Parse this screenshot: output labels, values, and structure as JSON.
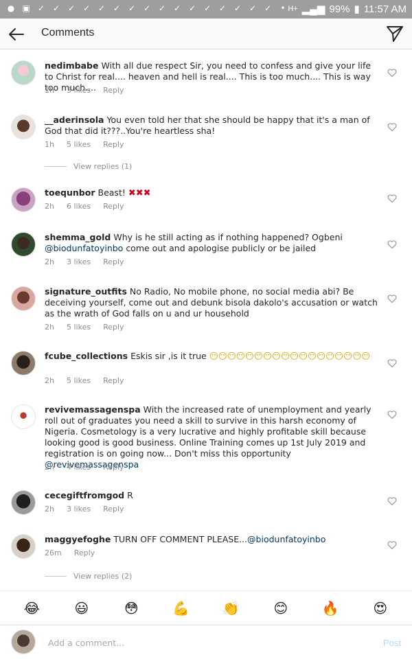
{
  "status_bar": {
    "battery": "99%",
    "time": "11:57 AM",
    "network": "H+"
  },
  "header": {
    "title": "Comments"
  },
  "comments": [
    {
      "user": "nedimbabe",
      "text": "With all due respect Sir, you need to confess and give your life to Christ for real.... heaven and hell is real.... This is too much.... This is way too much....",
      "time": "1h",
      "likes": "3 likes",
      "reply": "Reply"
    },
    {
      "user": "__aderinsola",
      "text": "You even told her that she should be happy that it's a man of God that did it???..You're heartless sha!",
      "time": "1h",
      "likes": "5 likes",
      "reply": "Reply",
      "view_replies": "View replies (1)"
    },
    {
      "user": "toequnbor",
      "text": "Beast!",
      "emoji": "✖✖✖",
      "time": "2h",
      "likes": "6 likes",
      "reply": "Reply"
    },
    {
      "user": "shemma_gold",
      "text_a": "Why is he still acting as if nothing happened? Ogbeni",
      "mention": "@biodunfatoyinbo",
      "text_b": "come out and apologise publicly or be jailed",
      "time": "2h",
      "likes": "3 likes",
      "reply": "Reply"
    },
    {
      "user": "signature_outfits",
      "text": "No Radio, No mobile phone, no social media abi? Be deceiving yourself, come out and debunk bisola dakolo's accusation or watch as the wrath of God falls on u and ur household",
      "time": "2h",
      "likes": "5 likes",
      "reply": "Reply"
    },
    {
      "user": "fcube_collections",
      "text": "Eskis sir ,is it true",
      "emoji": "😶😶😶😶😶😶😶😶😶😶😶😶😶😶😶😶😶😶",
      "time": "2h",
      "likes": "5 likes",
      "reply": "Reply"
    },
    {
      "user": "revivemassagenspa",
      "text": "With the increased rate of unemployment and yearly roll out of graduates you need a skill to survive in this harsh economy of Nigeria. Cosmetology is a very lucrative and highly profitable skill because looking good is good business. Online Training comes up 1st July 2019 and registration is on going now... Don't miss this opportunity",
      "mention": "@revivemassagenspa",
      "time": "2h",
      "likes": "4 likes",
      "reply": "Reply"
    },
    {
      "user": "cecegiftfromgod",
      "text": "R",
      "time": "2h",
      "likes": "3 likes",
      "reply": "Reply"
    },
    {
      "user": "maggyefoghe",
      "text": "TURN OFF COMMENT PLEASE...",
      "mention": "@biodunfatoyinbo",
      "time": "26m",
      "reply": "Reply",
      "view_replies": "View replies (2)"
    }
  ],
  "emoji_bar": [
    "😂",
    "😃",
    "😳",
    "💪",
    "👏",
    "😊",
    "🔥",
    "😍"
  ],
  "composer": {
    "placeholder": "Add a comment...",
    "post_label": "Post"
  },
  "colors": {
    "status_bar": "#9e9e9e",
    "mention": "#003569",
    "meta": "#8e8e8e",
    "post_disabled": "#b3dbff"
  },
  "icons": [
    "back-arrow-icon",
    "send-icon",
    "heart-icon"
  ]
}
